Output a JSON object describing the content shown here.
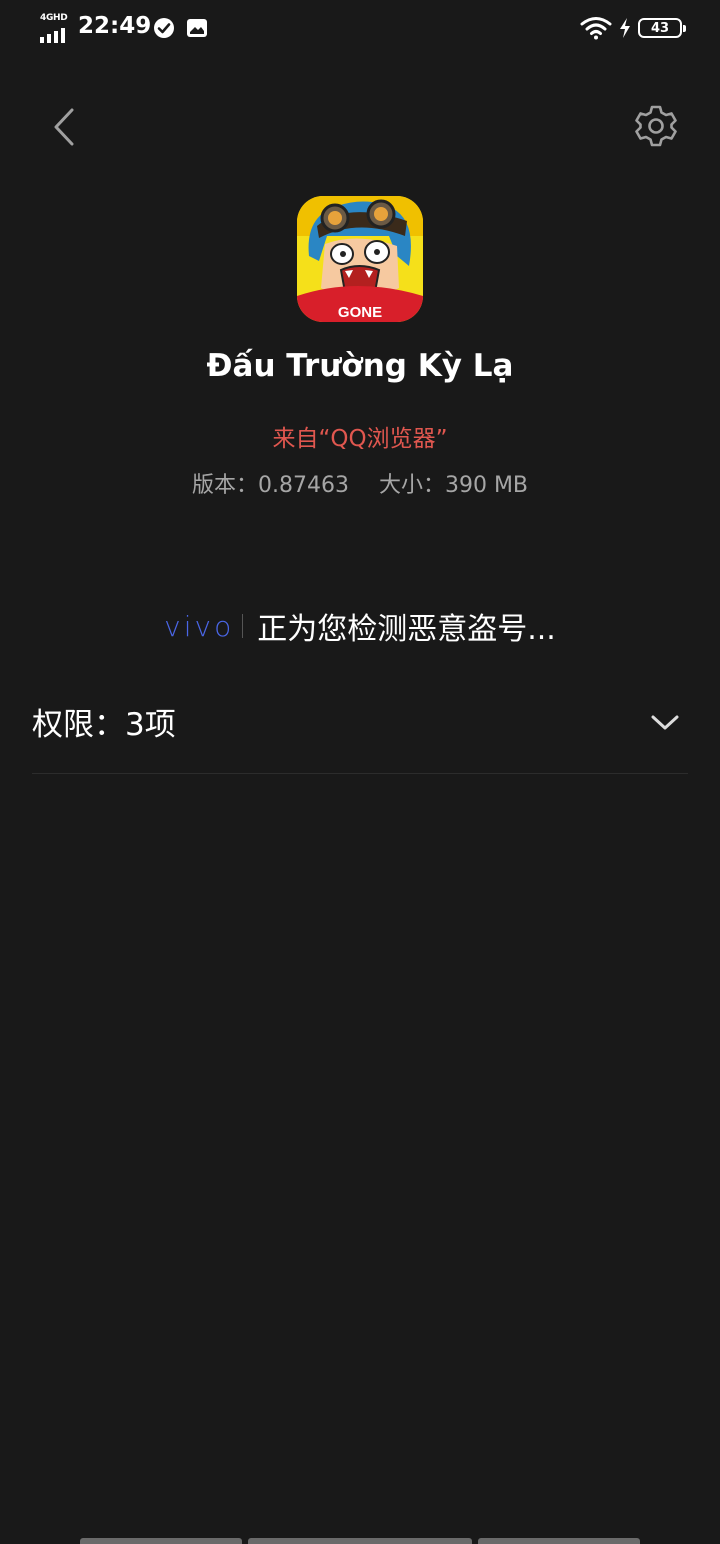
{
  "status_bar": {
    "network": "4GHD",
    "time": "22:49",
    "battery": "43",
    "icons": [
      "check-circle-icon",
      "gallery-icon",
      "wifi-icon",
      "charging-icon",
      "battery-icon"
    ]
  },
  "nav": {
    "back_icon": "chevron-left-icon",
    "settings_icon": "gear-icon"
  },
  "app": {
    "name": "Đấu Trường Kỳ Lạ",
    "source": "来自“QQ浏览器”",
    "version": "版本：0.87463",
    "size": "大小：390 MB",
    "icon_badge": "GONE"
  },
  "scan": {
    "brand": "vivo",
    "message": "正为您检测恶意盗号..."
  },
  "permissions": {
    "label": "权限：3项",
    "toggle_icon": "chevron-down-icon"
  },
  "colors": {
    "background": "#191919",
    "source_red": "#e0574f",
    "vivo_blue": "#4a66e6",
    "meta_gray": "#a6a6a6"
  }
}
